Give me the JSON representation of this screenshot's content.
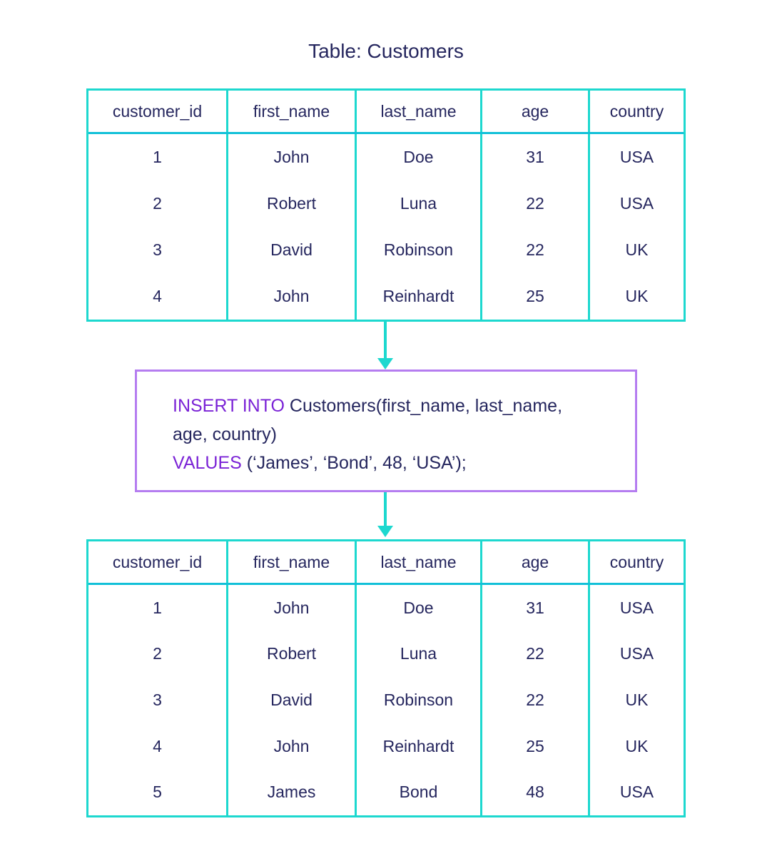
{
  "title": "Table: Customers",
  "columns": [
    "customer_id",
    "first_name",
    "last_name",
    "age",
    "country"
  ],
  "table_before": [
    [
      "1",
      "John",
      "Doe",
      "31",
      "USA"
    ],
    [
      "2",
      "Robert",
      "Luna",
      "22",
      "USA"
    ],
    [
      "3",
      "David",
      "Robinson",
      "22",
      "UK"
    ],
    [
      "4",
      "John",
      "Reinhardt",
      "25",
      "UK"
    ]
  ],
  "sql": {
    "kw_insert": "INSERT INTO",
    "line1_rest": " Customers(first_name, last_name,",
    "line2": "age, country)",
    "kw_values": "VALUES",
    "line3_rest": " (‘James’, ‘Bond’, 48, ‘USA’);"
  },
  "table_after": [
    [
      "1",
      "John",
      "Doe",
      "31",
      "USA"
    ],
    [
      "2",
      "Robert",
      "Luna",
      "22",
      "USA"
    ],
    [
      "3",
      "David",
      "Robinson",
      "22",
      "UK"
    ],
    [
      "4",
      "John",
      "Reinhardt",
      "25",
      "UK"
    ],
    [
      "5",
      "James",
      "Bond",
      "48",
      "USA"
    ]
  ],
  "colors": {
    "table_border": "#1dd8cf",
    "sql_border": "#b57df0",
    "keyword": "#7a22d6",
    "text": "#25265e"
  }
}
